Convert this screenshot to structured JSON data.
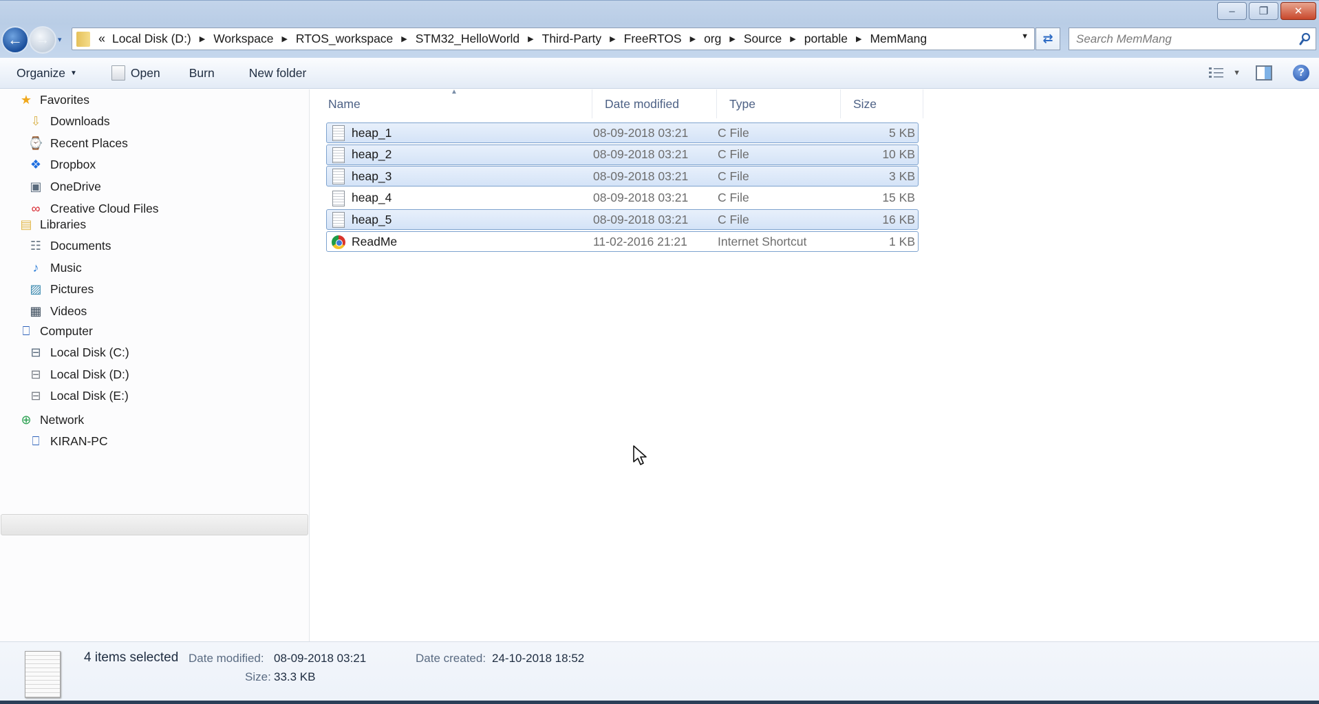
{
  "window": {
    "minimize_label": "–",
    "restore_label": "❐",
    "close_label": "✕"
  },
  "navigation": {
    "back_icon": "←",
    "forward_icon": "→",
    "recent_dropdown_icon": "▾"
  },
  "address_bar": {
    "overflow_label": "«",
    "separator": "▶",
    "crumbs": [
      "Local Disk (D:)",
      "Workspace",
      "RTOS_workspace",
      "STM32_HelloWorld",
      "Third-Party",
      "FreeRTOS",
      "org",
      "Source",
      "portable",
      "MemMang"
    ],
    "dropdown_icon": "▼",
    "refresh_icon": "⇄"
  },
  "search": {
    "placeholder": "Search MemMang",
    "value": ""
  },
  "toolbar": {
    "organize_label": "Organize",
    "organize_caret": "▼",
    "open_label": "Open",
    "burn_label": "Burn",
    "new_folder_label": "New folder",
    "views_caret": "▼",
    "help_label": "?"
  },
  "sidebar": {
    "groups": [
      {
        "label": "Favorites",
        "icon": "star-icon",
        "glyph": "★",
        "items": [
          {
            "label": "Downloads",
            "icon": "downloads-folder-icon",
            "glyph": "⇩"
          },
          {
            "label": "Recent Places",
            "icon": "recent-places-icon",
            "glyph": "⌚"
          },
          {
            "label": "Dropbox",
            "icon": "dropbox-icon",
            "glyph": "❖"
          },
          {
            "label": "OneDrive",
            "icon": "onedrive-icon",
            "glyph": "▣"
          },
          {
            "label": "Creative Cloud Files",
            "icon": "creative-cloud-icon",
            "glyph": "∞"
          }
        ]
      },
      {
        "label": "Libraries",
        "icon": "libraries-icon",
        "glyph": "▤",
        "items": [
          {
            "label": "Documents",
            "icon": "documents-icon",
            "glyph": "☷"
          },
          {
            "label": "Music",
            "icon": "music-icon",
            "glyph": "♪"
          },
          {
            "label": "Pictures",
            "icon": "pictures-icon",
            "glyph": "▨"
          },
          {
            "label": "Videos",
            "icon": "videos-icon",
            "glyph": "▦"
          }
        ]
      },
      {
        "label": "Computer",
        "icon": "computer-icon",
        "glyph": "⎕",
        "items": [
          {
            "label": "Local Disk (C:)",
            "icon": "system-drive-icon",
            "glyph": "⊟"
          },
          {
            "label": "Local Disk (D:)",
            "icon": "drive-icon",
            "glyph": "⊟",
            "selected": true
          },
          {
            "label": "Local Disk (E:)",
            "icon": "drive-icon",
            "glyph": "⊟"
          }
        ]
      },
      {
        "label": "Network",
        "icon": "network-icon",
        "glyph": "⊕",
        "items": [
          {
            "label": "KIRAN-PC",
            "icon": "computer-icon",
            "glyph": "⎕"
          }
        ]
      }
    ]
  },
  "file_list": {
    "columns": {
      "name": "Name",
      "date_modified": "Date modified",
      "type": "Type",
      "size": "Size"
    },
    "sort_indicator": "▲",
    "rows": [
      {
        "name": "heap_1",
        "date_modified": "08-09-2018 03:21",
        "type": "C File",
        "size": "5 KB",
        "selected": true,
        "icon": "c-file-icon"
      },
      {
        "name": "heap_2",
        "date_modified": "08-09-2018 03:21",
        "type": "C File",
        "size": "10 KB",
        "selected": true,
        "icon": "c-file-icon"
      },
      {
        "name": "heap_3",
        "date_modified": "08-09-2018 03:21",
        "type": "C File",
        "size": "3 KB",
        "selected": true,
        "icon": "c-file-icon"
      },
      {
        "name": "heap_4",
        "date_modified": "08-09-2018 03:21",
        "type": "C File",
        "size": "15 KB",
        "selected": false,
        "icon": "c-file-icon"
      },
      {
        "name": "heap_5",
        "date_modified": "08-09-2018 03:21",
        "type": "C File",
        "size": "16 KB",
        "selected": true,
        "icon": "c-file-icon"
      },
      {
        "name": "ReadMe",
        "date_modified": "11-02-2016 21:21",
        "type": "Internet Shortcut",
        "size": "1 KB",
        "selected": false,
        "focused": true,
        "icon": "internet-shortcut-icon"
      }
    ]
  },
  "details_pane": {
    "selection_count": "4 items selected",
    "date_modified_label": "Date modified:",
    "date_modified_value": "08-09-2018 03:21",
    "size_label": "Size:",
    "size_value": "33.3 KB",
    "date_created_label": "Date created:",
    "date_created_value": "24-10-2018 18:52"
  },
  "colors": {
    "selection_fill": "#d9e6f8",
    "selection_border": "#7da2ce",
    "header_text": "#4d6185",
    "chrome_blue": "#b9cde6"
  }
}
